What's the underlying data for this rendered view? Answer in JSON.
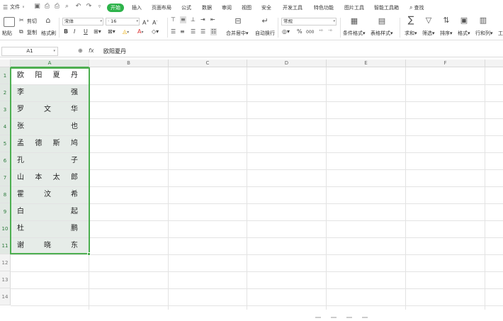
{
  "menu": {
    "file_label": "文件",
    "tabs": [
      "开始",
      "插入",
      "页面布局",
      "公式",
      "数据",
      "审阅",
      "视图",
      "安全",
      "开发工具",
      "特色功能",
      "图片工具",
      "智能工具箱"
    ],
    "active_tab": "开始",
    "search_label": "查找"
  },
  "ribbon": {
    "paste_label": "粘贴",
    "cut_label": "剪切",
    "copy_label": "复制",
    "format_painter_label": "格式刷",
    "font_name": "宋体",
    "font_size": "16",
    "bold": "B",
    "italic": "I",
    "underline": "U",
    "merge_label": "合并居中",
    "wrap_label": "自动换行",
    "number_format": "常规",
    "percent": "%",
    "thousands": "000",
    "cond_format_label": "条件格式",
    "table_style_label": "表格样式",
    "sum_label": "求和",
    "filter_label": "筛选",
    "sort_label": "排序",
    "format_label": "格式",
    "rowcol_label": "行和列",
    "worksheet_label": "工"
  },
  "formula_bar": {
    "cell_ref": "A1",
    "fx_label": "fx",
    "content": "欧阳夏丹"
  },
  "columns": [
    "A",
    "B",
    "C",
    "D",
    "E",
    "F"
  ],
  "rows": [
    "1",
    "2",
    "3",
    "4",
    "5",
    "6",
    "7",
    "8",
    "9",
    "10",
    "11",
    "12",
    "13",
    "14"
  ],
  "cells_a": [
    [
      "欧",
      "阳",
      "夏",
      "丹"
    ],
    [
      "李",
      "强"
    ],
    [
      "罗",
      "文",
      "华"
    ],
    [
      "张",
      "也"
    ],
    [
      "孟",
      "德",
      "斯",
      "鸠"
    ],
    [
      "孔",
      "子"
    ],
    [
      "山",
      "本",
      "太",
      "郎"
    ],
    [
      "霍",
      "汶",
      "希"
    ],
    [
      "白",
      "起"
    ],
    [
      "杜",
      "鹏"
    ],
    [
      "谢",
      "晓",
      "东"
    ]
  ]
}
